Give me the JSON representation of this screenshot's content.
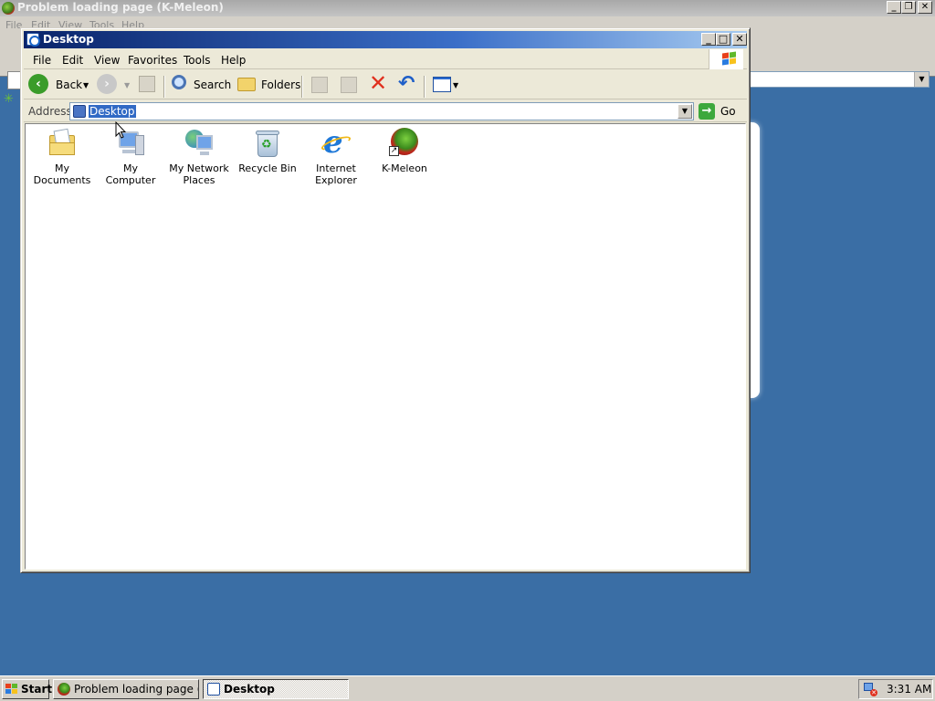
{
  "background_window": {
    "title": "Problem loading page (K-Meleon)",
    "menu": [
      "File",
      "Edit",
      "View",
      "Tools",
      "Help"
    ],
    "caption_buttons": [
      "_",
      "❐",
      "✕"
    ]
  },
  "explorer": {
    "title": "Desktop",
    "caption_buttons": [
      "_",
      "□",
      "✕"
    ],
    "menu": [
      "File",
      "Edit",
      "View",
      "Favorites",
      "Tools",
      "Help"
    ],
    "toolbar": {
      "back_label": "Back",
      "search_label": "Search",
      "folders_label": "Folders"
    },
    "address": {
      "label": "Address",
      "value": "Desktop",
      "go_label": "Go"
    },
    "items": [
      {
        "label": "My Documents"
      },
      {
        "label": "My Computer"
      },
      {
        "label": "My Network Places"
      },
      {
        "label": "Recycle Bin"
      },
      {
        "label": "Internet Explorer"
      },
      {
        "label": "K-Meleon"
      }
    ]
  },
  "taskbar": {
    "start_label": "Start",
    "tasks": [
      {
        "label": "Problem loading page (K-..."
      },
      {
        "label": "Desktop"
      }
    ],
    "clock": "3:31 AM"
  },
  "colors": {
    "desktop_bg": "#3a6ea5",
    "title_active_start": "#0a246a",
    "title_active_end": "#a6caf0",
    "selection": "#316ac5"
  }
}
